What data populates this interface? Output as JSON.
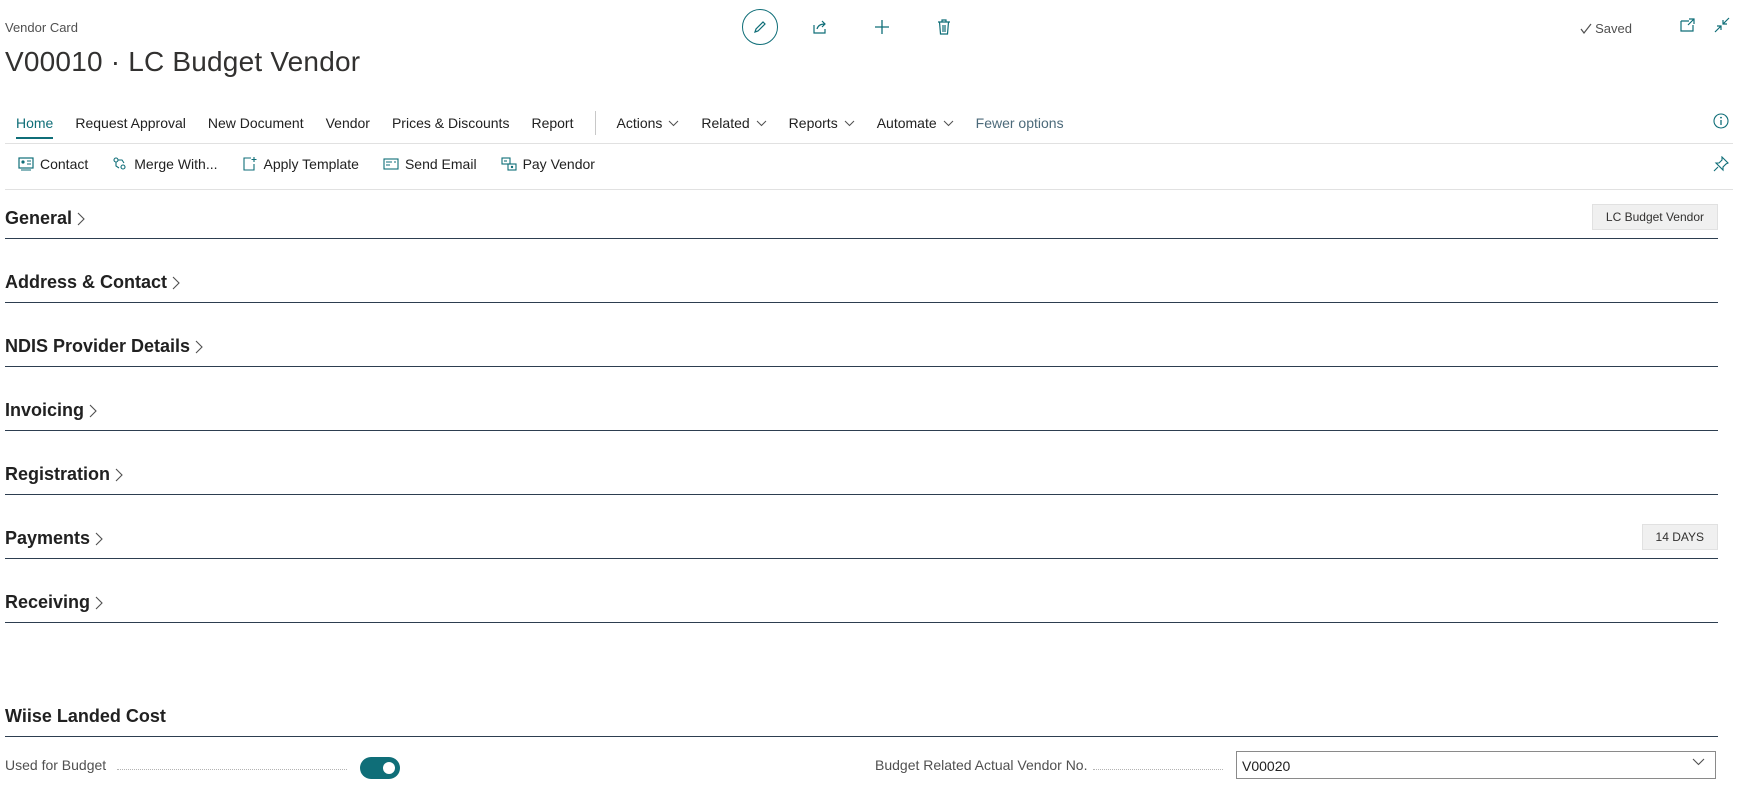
{
  "header": {
    "page_label": "Vendor Card",
    "page_title": "V00010 · LC Budget Vendor",
    "status": "Saved"
  },
  "menu": {
    "home": "Home",
    "request_approval": "Request Approval",
    "new_document": "New Document",
    "vendor": "Vendor",
    "prices_discounts": "Prices & Discounts",
    "report": "Report",
    "actions": "Actions",
    "related": "Related",
    "reports": "Reports",
    "automate": "Automate",
    "fewer_options": "Fewer options"
  },
  "actionbar": {
    "contact": "Contact",
    "merge_with": "Merge With...",
    "apply_template": "Apply Template",
    "send_email": "Send Email",
    "pay_vendor": "Pay Vendor"
  },
  "sections": {
    "general": {
      "title": "General",
      "badge": "LC Budget Vendor"
    },
    "address_contact": {
      "title": "Address & Contact"
    },
    "ndis_provider": {
      "title": "NDIS Provider Details"
    },
    "invoicing": {
      "title": "Invoicing"
    },
    "registration": {
      "title": "Registration"
    },
    "payments": {
      "title": "Payments",
      "badge": "14 DAYS"
    },
    "receiving": {
      "title": "Receiving"
    },
    "wiise_landed_cost": {
      "title": "Wiise Landed Cost"
    }
  },
  "fields": {
    "used_for_budget": {
      "label": "Used for Budget",
      "value": true
    },
    "budget_related_vendor": {
      "label": "Budget Related Actual Vendor No.",
      "value": "V00020"
    }
  },
  "colors": {
    "accent": "#0f6e78",
    "section_line": "#2d3e50"
  },
  "icons": [
    "edit-icon",
    "share-icon",
    "plus-icon",
    "delete-icon",
    "check-icon",
    "open-new-window-icon",
    "collapse-icon",
    "info-icon",
    "contact-icon",
    "merge-icon",
    "template-icon",
    "email-icon",
    "pay-icon",
    "pin-icon",
    "chevron-right-icon",
    "chevron-down-icon"
  ]
}
